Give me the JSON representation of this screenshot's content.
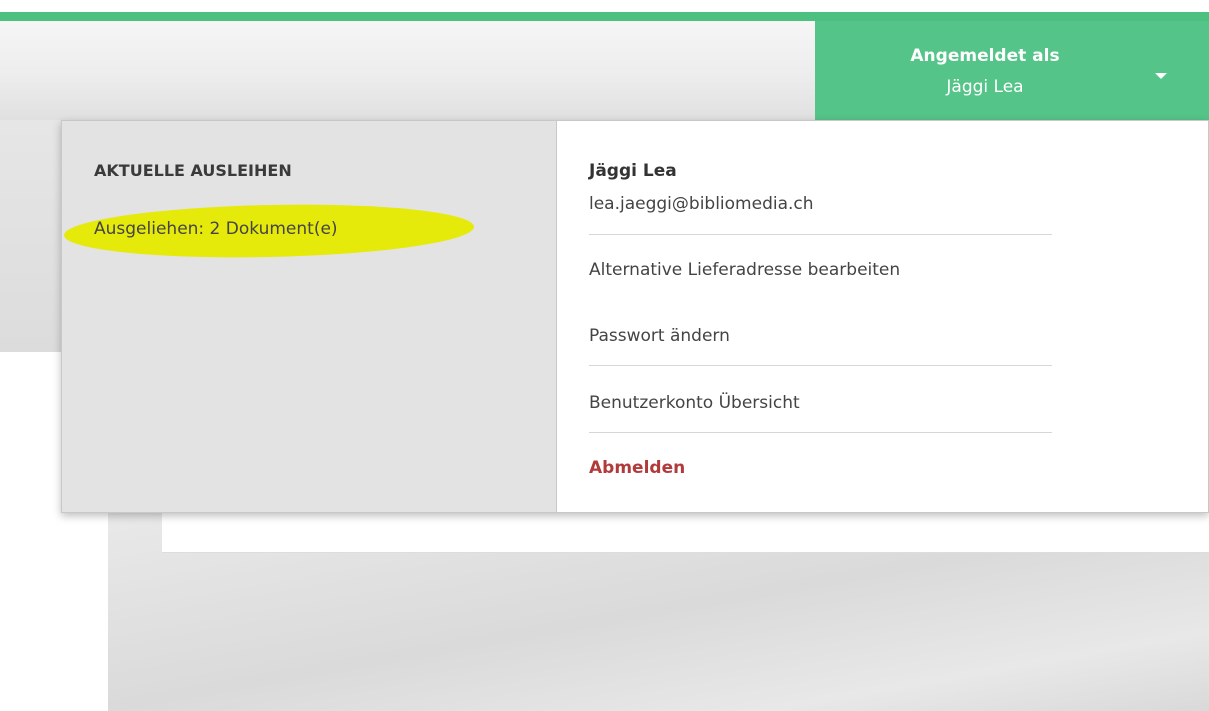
{
  "header": {
    "logged_in_label": "Angemeldet als",
    "user_name": "Jäggi Lea"
  },
  "loans": {
    "heading": "AKTUELLE AUSLEIHEN",
    "count_text": "Ausgeliehen: 2 Dokument(e)"
  },
  "account": {
    "name": "Jäggi Lea",
    "email": "lea.jaeggi@bibliomedia.ch",
    "items": [
      {
        "label": "Alternative Lieferadresse bearbeiten"
      },
      {
        "label": "Passwort ändern"
      },
      {
        "label": "Benutzerkonto Übersicht"
      },
      {
        "label": "Abmelden"
      }
    ]
  },
  "colors": {
    "accent_green": "#55c488",
    "logout_red": "#b13a3a",
    "highlight_yellow": "#e5ea0a"
  },
  "icons": {
    "menu_toggle": "caret-down-icon"
  }
}
